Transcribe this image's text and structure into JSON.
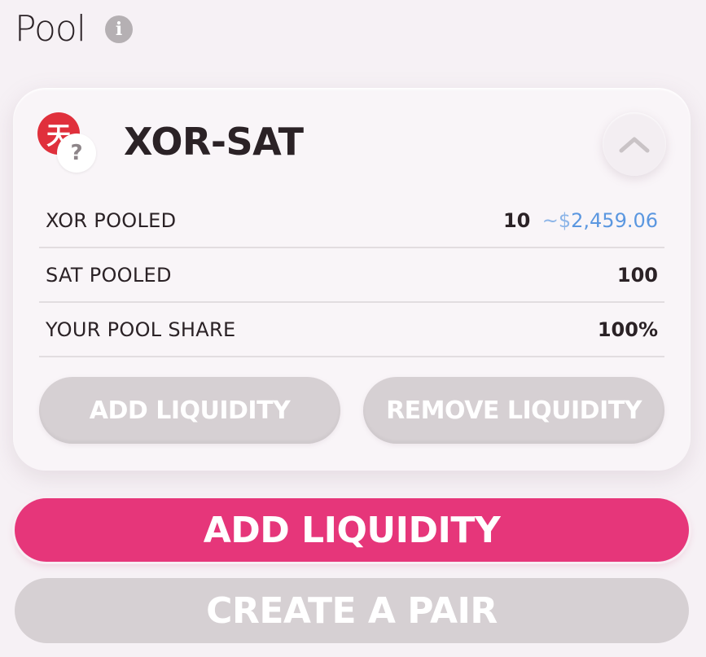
{
  "header": {
    "title": "Pool",
    "info_icon_glyph": "i",
    "info_icon_name": "info-icon"
  },
  "pool_card": {
    "pair_name": "XOR-SAT",
    "token_a_icon_glyph": "天",
    "token_b_icon_glyph": "?",
    "token_a_color": "#e0303c",
    "rows": [
      {
        "label": "XOR POOLED",
        "value": "10",
        "fiat_symbol": "~$",
        "fiat_value": "2,459.06"
      },
      {
        "label": "SAT POOLED",
        "value": "100"
      },
      {
        "label": "YOUR POOL SHARE",
        "value": "100%"
      }
    ],
    "add_liquidity_label": "ADD LIQUIDITY",
    "remove_liquidity_label": "REMOVE LIQUIDITY"
  },
  "actions": {
    "add_liquidity_label": "ADD LIQUIDITY",
    "create_pair_label": "CREATE A PAIR"
  },
  "colors": {
    "accent": "#e6367a",
    "disabled": "#d6d0d3",
    "fiat": "#5b97e0",
    "background": "#f6f1f5"
  }
}
